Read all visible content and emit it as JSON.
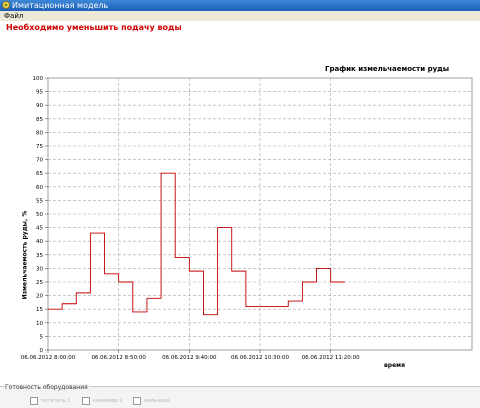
{
  "window": {
    "title": "Имитационная модель",
    "menu": [
      "Файл"
    ]
  },
  "warning": "Необходимо уменьшить подачу воды",
  "equipment_panel": {
    "title": "Готовность оборудования",
    "checkboxes": [
      {
        "label": "питатель 1",
        "checked": false
      },
      {
        "label": "конвейер 2",
        "checked": false
      },
      {
        "label": "мельница",
        "checked": false
      }
    ]
  },
  "colors": {
    "series": "#c00000",
    "warning": "#cc0000",
    "titlebar": "#1f5fb8"
  },
  "chart_data": {
    "type": "line",
    "title": "График измельчаемости руды",
    "xlabel": "время",
    "ylabel": "Измельчаемость руды, %",
    "ylim": [
      0,
      100
    ],
    "y_ticks": [
      0,
      5,
      10,
      15,
      20,
      25,
      30,
      35,
      40,
      45,
      50,
      55,
      60,
      65,
      70,
      75,
      80,
      85,
      90,
      95,
      100
    ],
    "x_ticks": [
      "06.06.2012 8:00:00",
      "06.06.2012 8:50:00",
      "06.06.2012 9:40:00",
      "06.06.2012 10:30:00",
      "06.06.2012 11:20:00"
    ],
    "x_minutes": [
      0,
      50,
      100,
      150,
      200
    ],
    "xlim_minutes": [
      0,
      300
    ],
    "grid": true,
    "step": true,
    "series": [
      {
        "times": [
          "8:00",
          "8:10",
          "8:20",
          "8:30",
          "8:40",
          "8:50",
          "9:00",
          "9:10",
          "9:20",
          "9:30",
          "9:40",
          "9:50",
          "10:00",
          "10:10",
          "10:20",
          "10:30",
          "10:40",
          "10:50",
          "11:00",
          "11:10",
          "11:20"
        ],
        "values": [
          15,
          17,
          21,
          43,
          28,
          25,
          14,
          19,
          65,
          34,
          29,
          13,
          45,
          29,
          16,
          16,
          16,
          18,
          25,
          30,
          25
        ]
      }
    ]
  }
}
